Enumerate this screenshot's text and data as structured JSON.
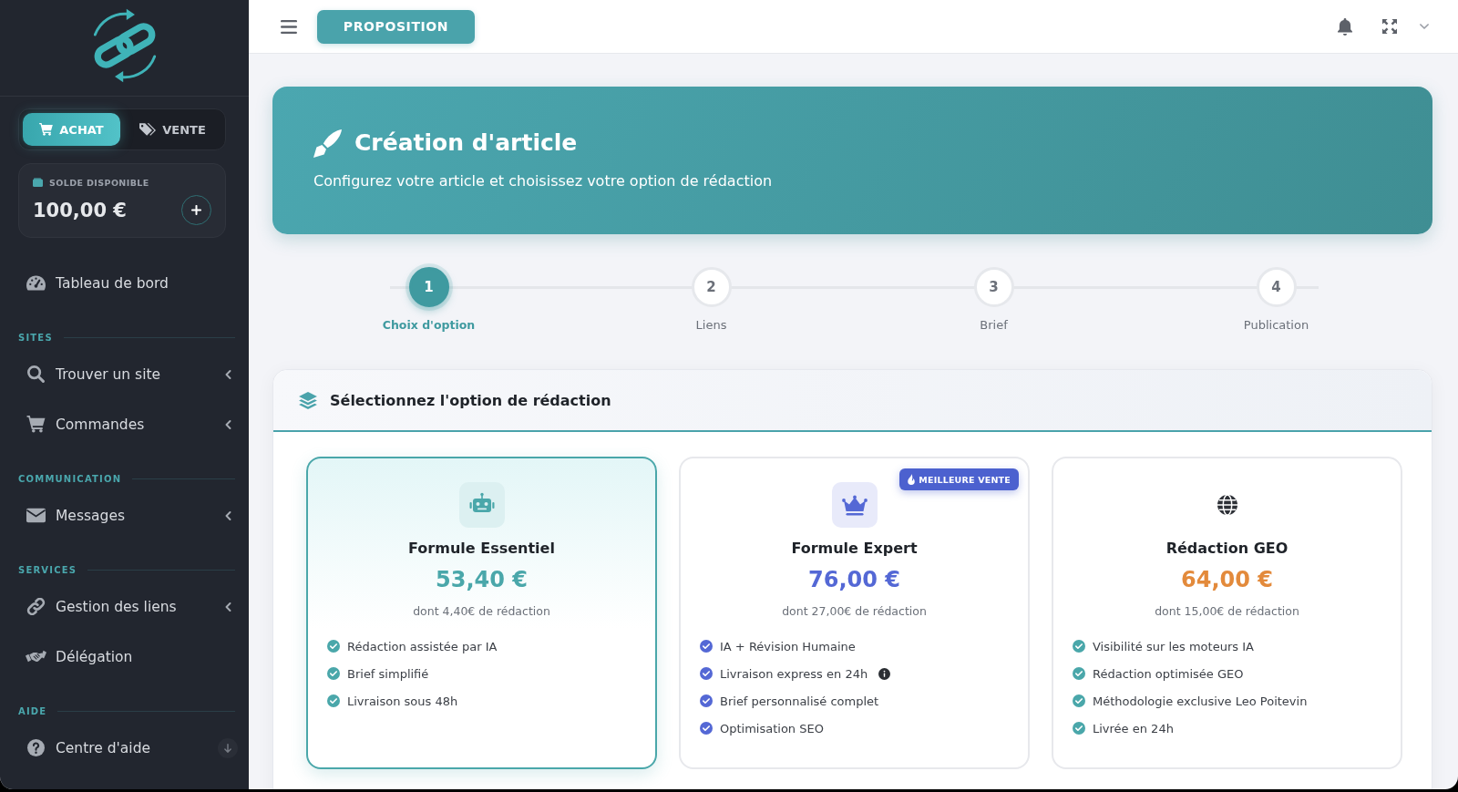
{
  "sidebar": {
    "mode_toggle": [
      {
        "label": "ACHAT",
        "selected": true
      },
      {
        "label": "VENTE",
        "selected": false
      }
    ],
    "balance": {
      "label": "SOLDE DISPONIBLE",
      "amount": "100,00 €"
    },
    "nav": [
      {
        "kind": "link",
        "label": "Tableau de bord"
      },
      {
        "kind": "heading",
        "label": "SITES"
      },
      {
        "kind": "submenu",
        "label": "Trouver un site"
      },
      {
        "kind": "submenu",
        "label": "Commandes"
      },
      {
        "kind": "heading",
        "label": "COMMUNICATION"
      },
      {
        "kind": "submenu",
        "label": "Messages"
      },
      {
        "kind": "heading",
        "label": "SERVICES"
      },
      {
        "kind": "submenu",
        "label": "Gestion des liens"
      },
      {
        "kind": "link",
        "label": "Délégation"
      },
      {
        "kind": "heading",
        "label": "AIDE"
      },
      {
        "kind": "link",
        "label": "Centre d'aide"
      }
    ]
  },
  "topbar": {
    "page_button": "PROPOSITION"
  },
  "banner": {
    "title": "Création d'article",
    "subtitle": "Configurez votre article et choisissez votre option de rédaction"
  },
  "steps": [
    {
      "number": "1",
      "label": "Choix d'option",
      "selected": true
    },
    {
      "number": "2",
      "label": "Liens",
      "selected": false
    },
    {
      "number": "3",
      "label": "Brief",
      "selected": false
    },
    {
      "number": "4",
      "label": "Publication",
      "selected": false
    }
  ],
  "options": {
    "title": "Sélectionnez l'option de rédaction",
    "cards": [
      {
        "title": "Formule Essentiel",
        "price": "53,40 €",
        "detail": "dont 4,40€ de rédaction",
        "color": "#4aa7aa",
        "selected": true,
        "features": [
          {
            "text": "Rédaction assistée par IA",
            "info": false
          },
          {
            "text": "Brief simplifié",
            "info": false
          },
          {
            "text": "Livraison sous 48h",
            "info": false
          }
        ]
      },
      {
        "title": "Formule Expert",
        "badge": "MEILLEURE VENTE",
        "price": "76,00 €",
        "detail": "dont 27,00€ de rédaction",
        "color": "#5468d5",
        "selected": false,
        "features": [
          {
            "text": "IA + Révision Humaine",
            "info": false
          },
          {
            "text": "Livraison express en 24h",
            "info": true
          },
          {
            "text": "Brief personnalisé complet",
            "info": false
          },
          {
            "text": "Optimisation SEO",
            "info": false
          }
        ]
      },
      {
        "title": "Rédaction GEO",
        "price": "64,00 €",
        "detail": "dont 15,00€ de rédaction",
        "color": "#e38a3b",
        "selected": false,
        "features": [
          {
            "text": "Visibilité sur les moteurs IA",
            "info": false
          },
          {
            "text": "Rédaction optimisée GEO",
            "info": false
          },
          {
            "text": "Méthodologie exclusive Leo Poitevin",
            "info": false
          },
          {
            "text": "Livrée en 24h",
            "info": false
          }
        ]
      }
    ]
  }
}
